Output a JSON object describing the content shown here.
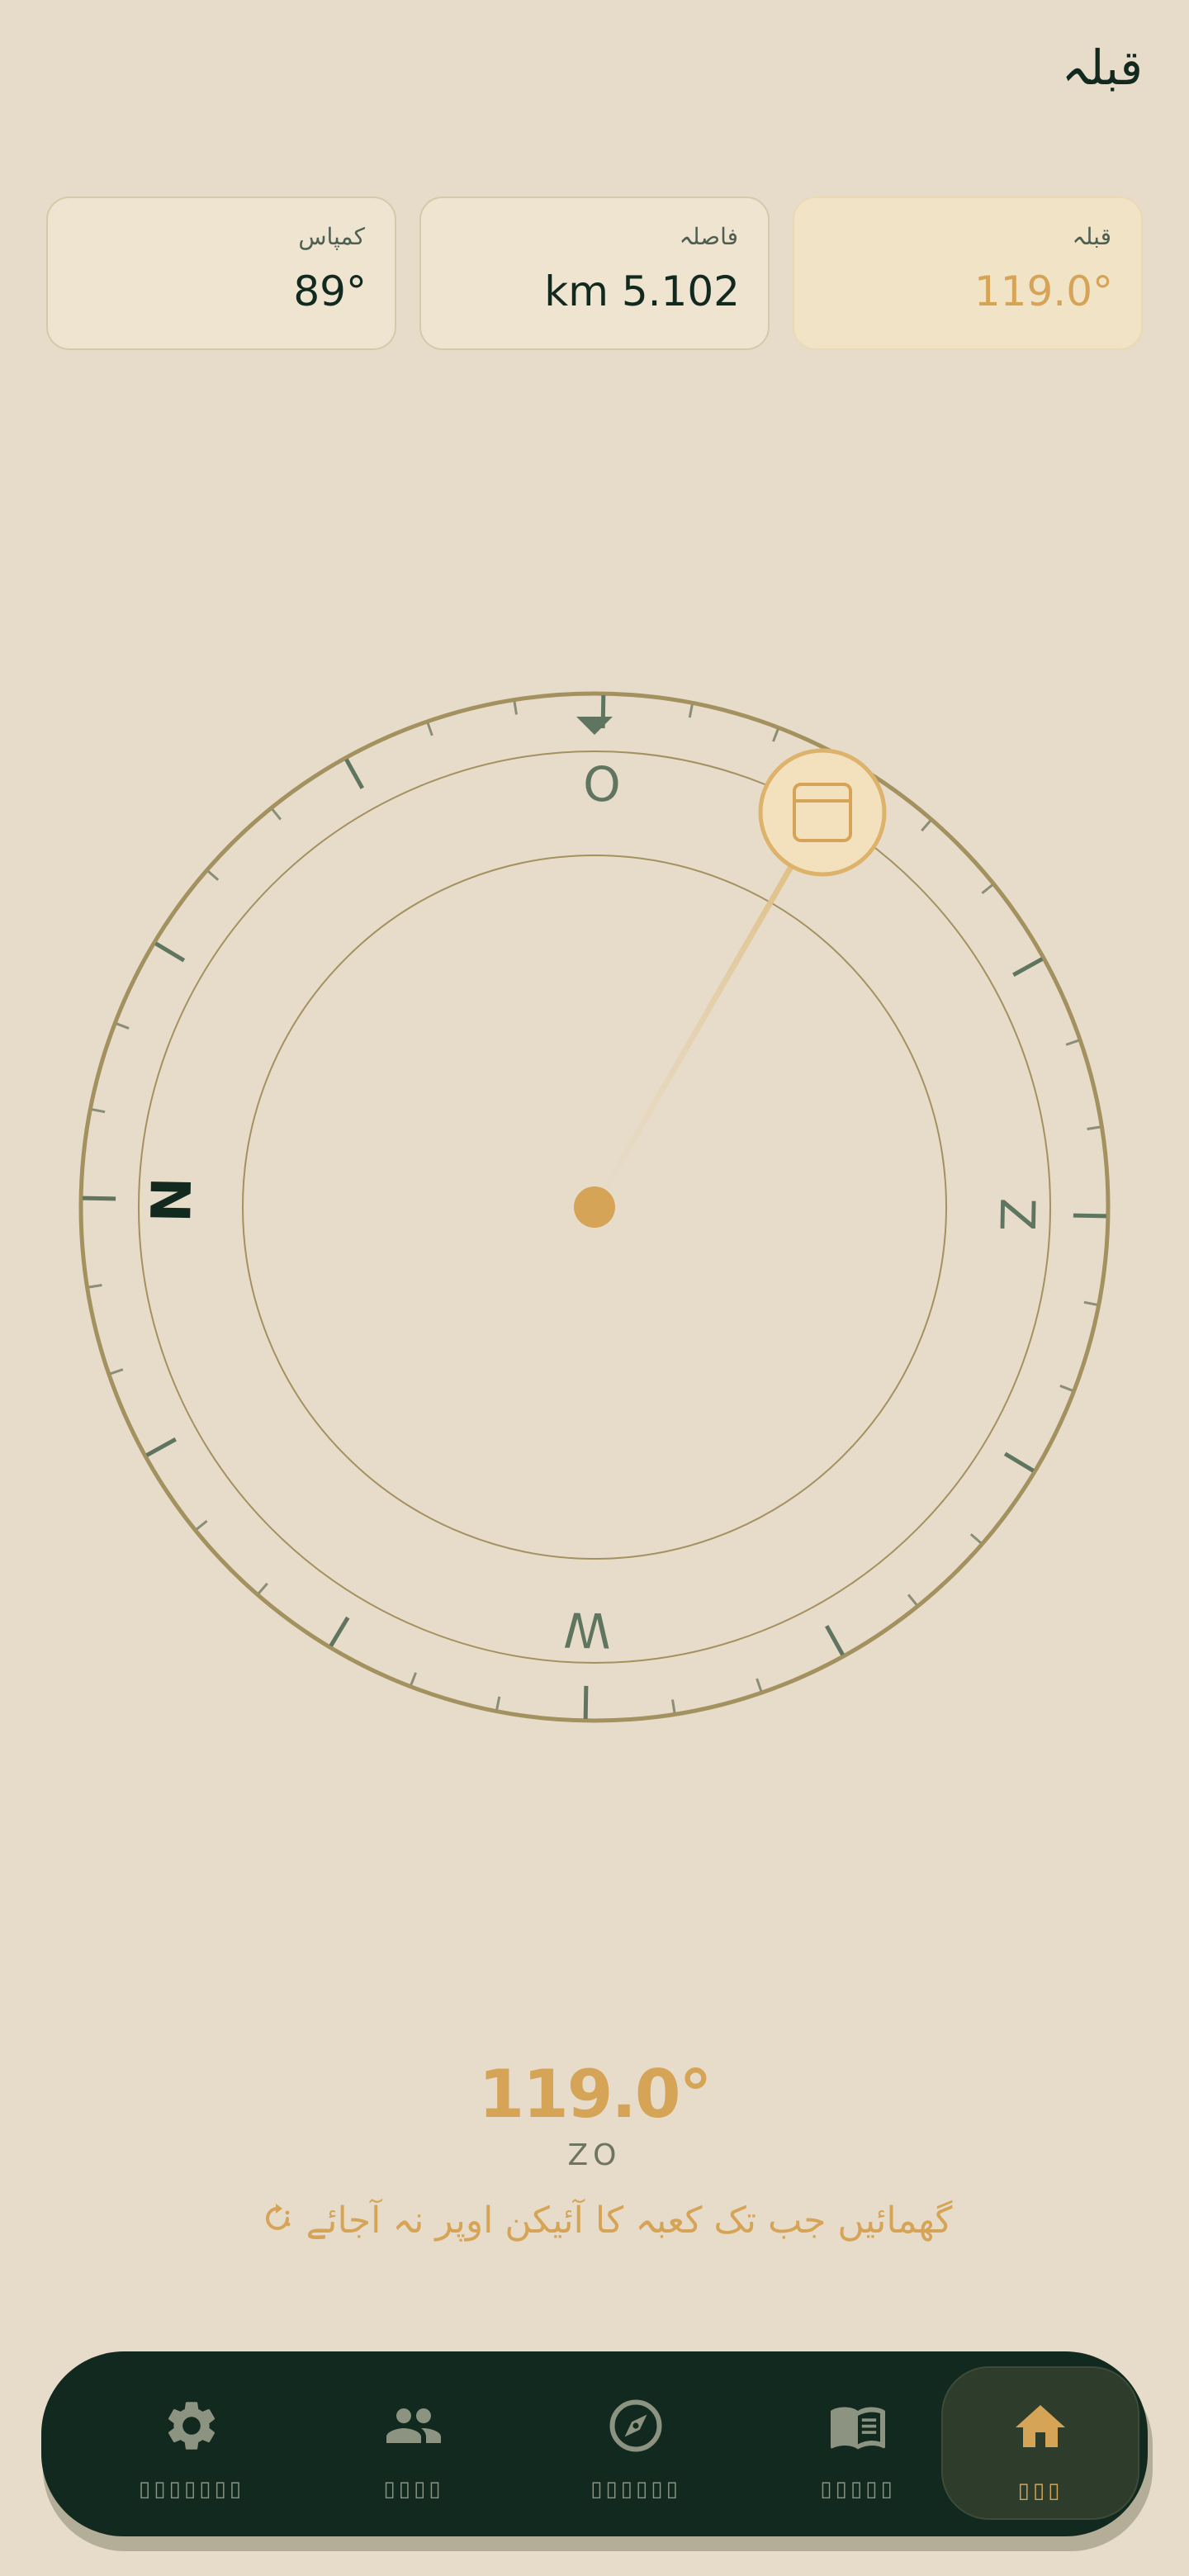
{
  "header": {
    "title": "قبلہ"
  },
  "cards": [
    {
      "id": "compass",
      "label": "کمپاس",
      "value": "89°"
    },
    {
      "id": "distance",
      "label": "فاصلہ",
      "value": "km 5.102"
    },
    {
      "id": "qibla",
      "label": "قبلہ",
      "value": "119.0°"
    }
  ],
  "compass": {
    "heading_deg": 89,
    "qibla_deg": 119,
    "cardinals": {
      "north": "N",
      "east": "O",
      "south": "Z",
      "west": "W"
    }
  },
  "readout": {
    "degrees": "119.0°",
    "direction": "ZO",
    "hint": "گھمائیں جب تک کعبہ کا آئیکن اوپر نہ آجائے"
  },
  "nav": {
    "items": [
      {
        "id": "settings",
        "icon": "gear-icon",
        "label": "▯▯▯▯▯▯▯"
      },
      {
        "id": "community",
        "icon": "people-icon",
        "label": "▯▯▯▯"
      },
      {
        "id": "qibla",
        "icon": "compass-icon",
        "label": "▯▯▯▯▯▯"
      },
      {
        "id": "quran",
        "icon": "book-icon",
        "label": "▯▯▯▯▯"
      },
      {
        "id": "home",
        "icon": "home-icon",
        "label": "▯▯▯"
      }
    ],
    "active": "home"
  },
  "colors": {
    "background": "#E7DCC9",
    "dark": "#12291F",
    "accent": "#D6A457",
    "ring": "#A39160",
    "muted": "#5F7560"
  }
}
